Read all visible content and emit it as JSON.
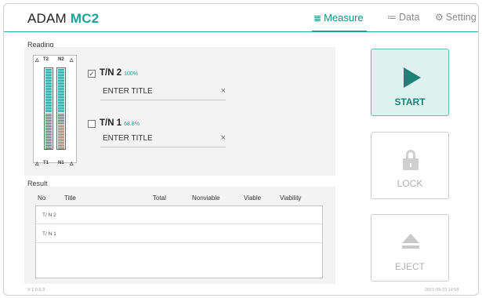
{
  "app": {
    "brand": "ADAM",
    "brand_accent": "MC2"
  },
  "nav": {
    "tabs": [
      {
        "label": "Measure",
        "icon": "list-icon",
        "active": true
      },
      {
        "label": "Data",
        "icon": "list-icon",
        "active": false
      },
      {
        "label": "Setting",
        "icon": "gear-icon",
        "active": false
      }
    ]
  },
  "reading": {
    "label": "Reading",
    "cartridge": {
      "top_left": "T2",
      "top_right": "N2",
      "bottom_left": "T1",
      "bottom_right": "N1"
    },
    "slots": [
      {
        "name": "T/N 2",
        "percent": "100%",
        "checked": true,
        "title": "ENTER TITLE",
        "clear": "×"
      },
      {
        "name": "T/N 1",
        "percent": "68.8%",
        "checked": false,
        "title": "ENTER TITLE",
        "clear": "×"
      }
    ]
  },
  "result": {
    "label": "Result",
    "columns": [
      "No",
      "Title",
      "Total",
      "Nonviable",
      "Viable",
      "Viability"
    ],
    "rows": [
      "T/ N 2",
      "T/ N 1"
    ]
  },
  "buttons": {
    "start": "START",
    "lock": "LOCK",
    "eject": "EJECT"
  },
  "footer": {
    "version": "V 1.0.0.3",
    "datetime": "2015-09-23 14:58"
  },
  "colors": {
    "accent": "#1aa495",
    "start_bg": "#ddf1ee",
    "panel_bg": "#f3f3f3"
  }
}
